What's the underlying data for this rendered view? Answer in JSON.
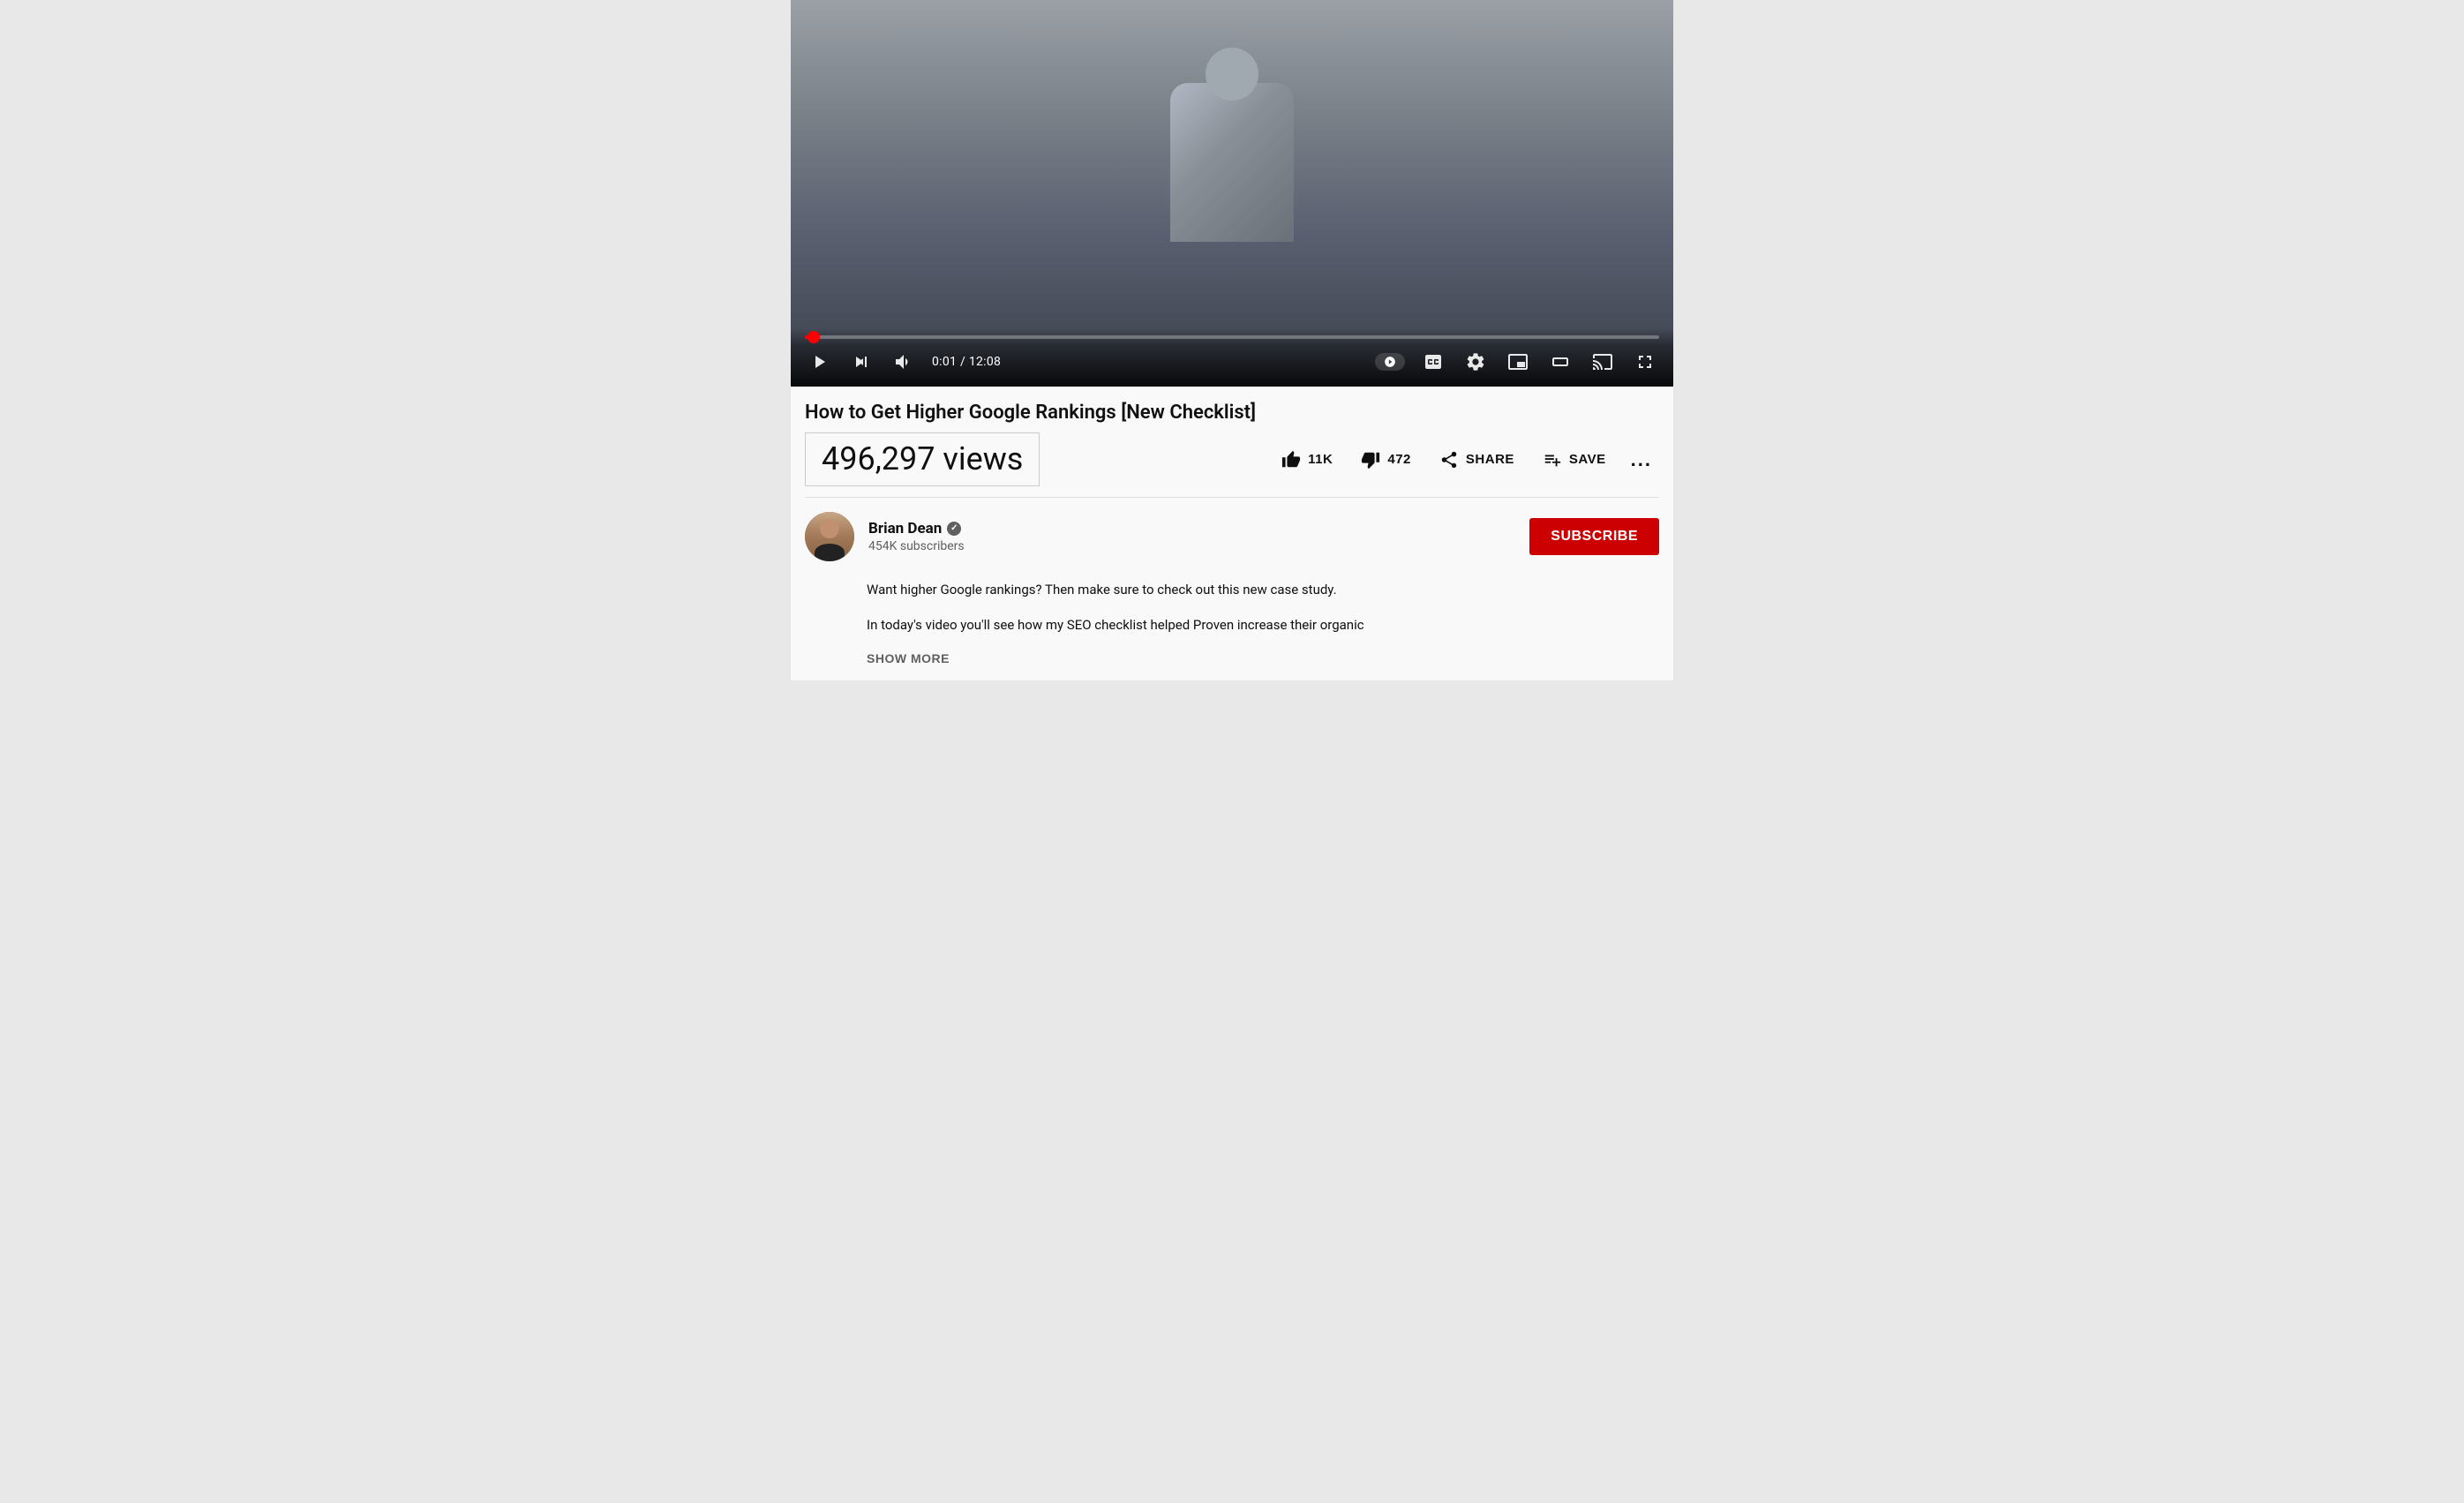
{
  "video": {
    "title": "How to Get Higher Google Rankings [New Checklist]",
    "views": "496,297 views",
    "current_time": "0:01",
    "duration": "12:08",
    "progress_percent": 0.14
  },
  "actions": {
    "like_label": "11K",
    "dislike_label": "472",
    "share_label": "SHARE",
    "save_label": "SAVE",
    "more_label": "..."
  },
  "channel": {
    "name": "Brian Dean",
    "subscribers": "454K subscribers",
    "subscribe_label": "SUBSCRIBE"
  },
  "description": {
    "line1": "Want higher Google rankings? Then make sure to check out this new case study.",
    "line2": "In today's video you'll see how my SEO checklist helped Proven increase their organic",
    "show_more": "SHOW MORE"
  },
  "controls": {
    "play_icon": "▶",
    "next_icon": "⏭",
    "volume_icon": "🔊",
    "time_separator": " / ",
    "speed_icon": "▶",
    "cc_icon": "CC",
    "settings_icon": "⚙",
    "miniplayer_icon": "⧉",
    "theater_icon": "⬛",
    "cast_icon": "⊡",
    "fullscreen_icon": "⛶"
  },
  "colors": {
    "progress_red": "#ff0000",
    "subscribe_red": "#cc0000",
    "bg_light": "#f9f9f9",
    "bg_page": "#e8e8e8",
    "text_primary": "#0f0f0f",
    "text_secondary": "#606060"
  }
}
